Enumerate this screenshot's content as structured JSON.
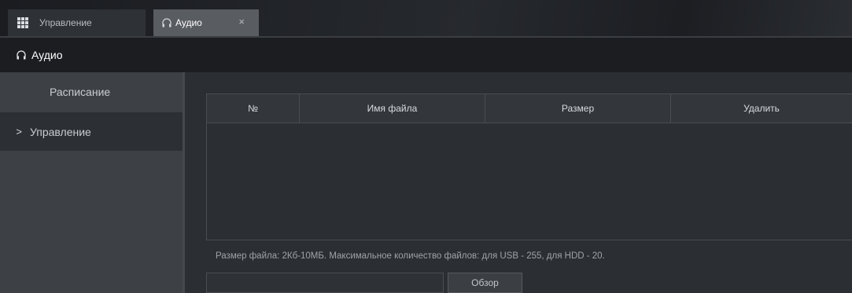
{
  "tabs": [
    {
      "label": "Управление",
      "icon": "grid-icon"
    },
    {
      "label": "Аудио",
      "icon": "headphones-icon",
      "close": "×"
    }
  ],
  "header": {
    "title": "Аудио",
    "icon": "headphones-icon"
  },
  "sidebar": {
    "items": [
      {
        "label": "Расписание",
        "active": false
      },
      {
        "label": "Управление",
        "active": true,
        "chevron": ">"
      }
    ]
  },
  "table": {
    "columns": [
      "№",
      "Имя файла",
      "Размер",
      "Удалить"
    ],
    "rows": []
  },
  "note": "Размер файла: 2Кб-10МБ. Максимальное количество файлов: для USB - 255, для HDD - 20.",
  "upload": {
    "file_value": "",
    "browse_label": "Обзор"
  },
  "colors": {
    "background": "#2b2e33",
    "sidebar": "#3d4045",
    "header": "#1b1d21",
    "active_tab": "#595c61"
  }
}
